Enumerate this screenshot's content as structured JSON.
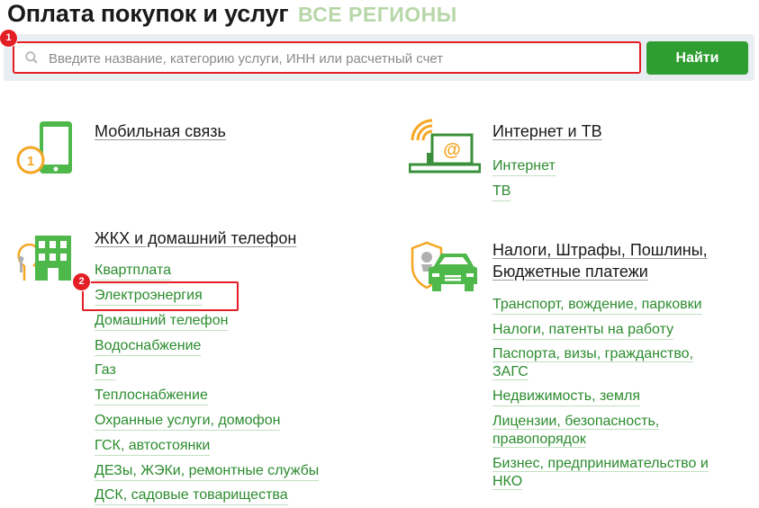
{
  "header": {
    "title": "Оплата покупок и услуг",
    "region": "ВСЕ РЕГИОНЫ"
  },
  "search": {
    "placeholder": "Введите название, категорию услуги, ИНН или расчетный счет",
    "value": "",
    "button": "Найти",
    "step_badge": "1"
  },
  "step2_badge": "2",
  "colors": {
    "accent_green": "#2f9e32",
    "link_green": "#2b8c2e",
    "highlight_red": "#e31e24",
    "icon_orange": "#f5a623"
  },
  "categories": {
    "mobile": {
      "title": "Мобильная связь",
      "icon": "mobile-phone-icon"
    },
    "internet": {
      "title": "Интернет и ТВ",
      "icon": "laptop-wifi-icon",
      "links": [
        "Интернет",
        "ТВ"
      ]
    },
    "housing": {
      "title": "ЖКХ и домашний телефон",
      "icon": "house-icon",
      "links": [
        "Квартплата",
        "Электроэнергия",
        "Домашний телефон",
        "Водоснабжение",
        "Газ",
        "Теплоснабжение",
        "Охранные услуги, домофон",
        "ГСК, автостоянки",
        "ДЕЗы, ЖЭКи, ремонтные службы",
        "ДСК, садовые товарищества"
      ]
    },
    "taxes": {
      "title_line1": "Налоги, Штрафы, Пошлины,",
      "title_line2": "Бюджетные платежи",
      "icon": "car-emblem-icon",
      "links": {
        "transport": "Транспорт, вождение, парковки",
        "taxes": "Налоги, патенты на работу",
        "passports_1": "Паспорта, визы, гражданство,",
        "passports_2": "ЗАГС",
        "realty": "Недвижимость, земля",
        "licenses_1": "Лицензии, безопасность,",
        "licenses_2": "правопорядок",
        "business_1": "Бизнес, предпринимательство и",
        "business_2": "НКО"
      }
    }
  }
}
